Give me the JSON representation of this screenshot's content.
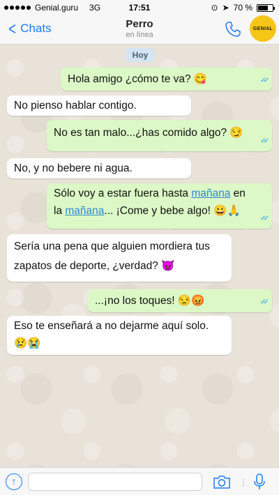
{
  "status_bar": {
    "carrier": "Genial.guru",
    "network": "3G",
    "time": "17:51",
    "battery": "70 %",
    "battery_level": 0.7
  },
  "header": {
    "back_label": "Chats",
    "contact_name": "Perro",
    "contact_status": "en línea",
    "brand_badge": "GENIAL"
  },
  "chat": {
    "date_label": "Hoy",
    "messages": [
      {
        "dir": "out",
        "text": "Hola amigo ¿cómo te va? 😋"
      },
      {
        "dir": "in",
        "text": "No pienso hablar contigo."
      },
      {
        "dir": "out",
        "text": "No es tan malo...¿has comido algo? 😏"
      },
      {
        "dir": "in",
        "text": "No, y no bebere ni agua."
      },
      {
        "dir": "out",
        "line1_a": "Sólo voy a estar fuera hasta ",
        "line1_link": "mañana",
        "line1_b": " en",
        "line2_a": "la ",
        "line2_link": "mañana",
        "line2_b": "... ¡Come y bebe algo! 😀🙏"
      },
      {
        "dir": "in",
        "line1": "Sería una pena que alguien mordiera tus",
        "line2": "zapatos de deporte, ¿verdad? 😈"
      },
      {
        "dir": "out",
        "text": "...¡no los toques! 😒😡"
      },
      {
        "dir": "in",
        "line1": "Eso te enseñará a no dejarme aquí solo.",
        "line2": "😢😭"
      }
    ]
  },
  "composer": {
    "placeholder": ""
  }
}
